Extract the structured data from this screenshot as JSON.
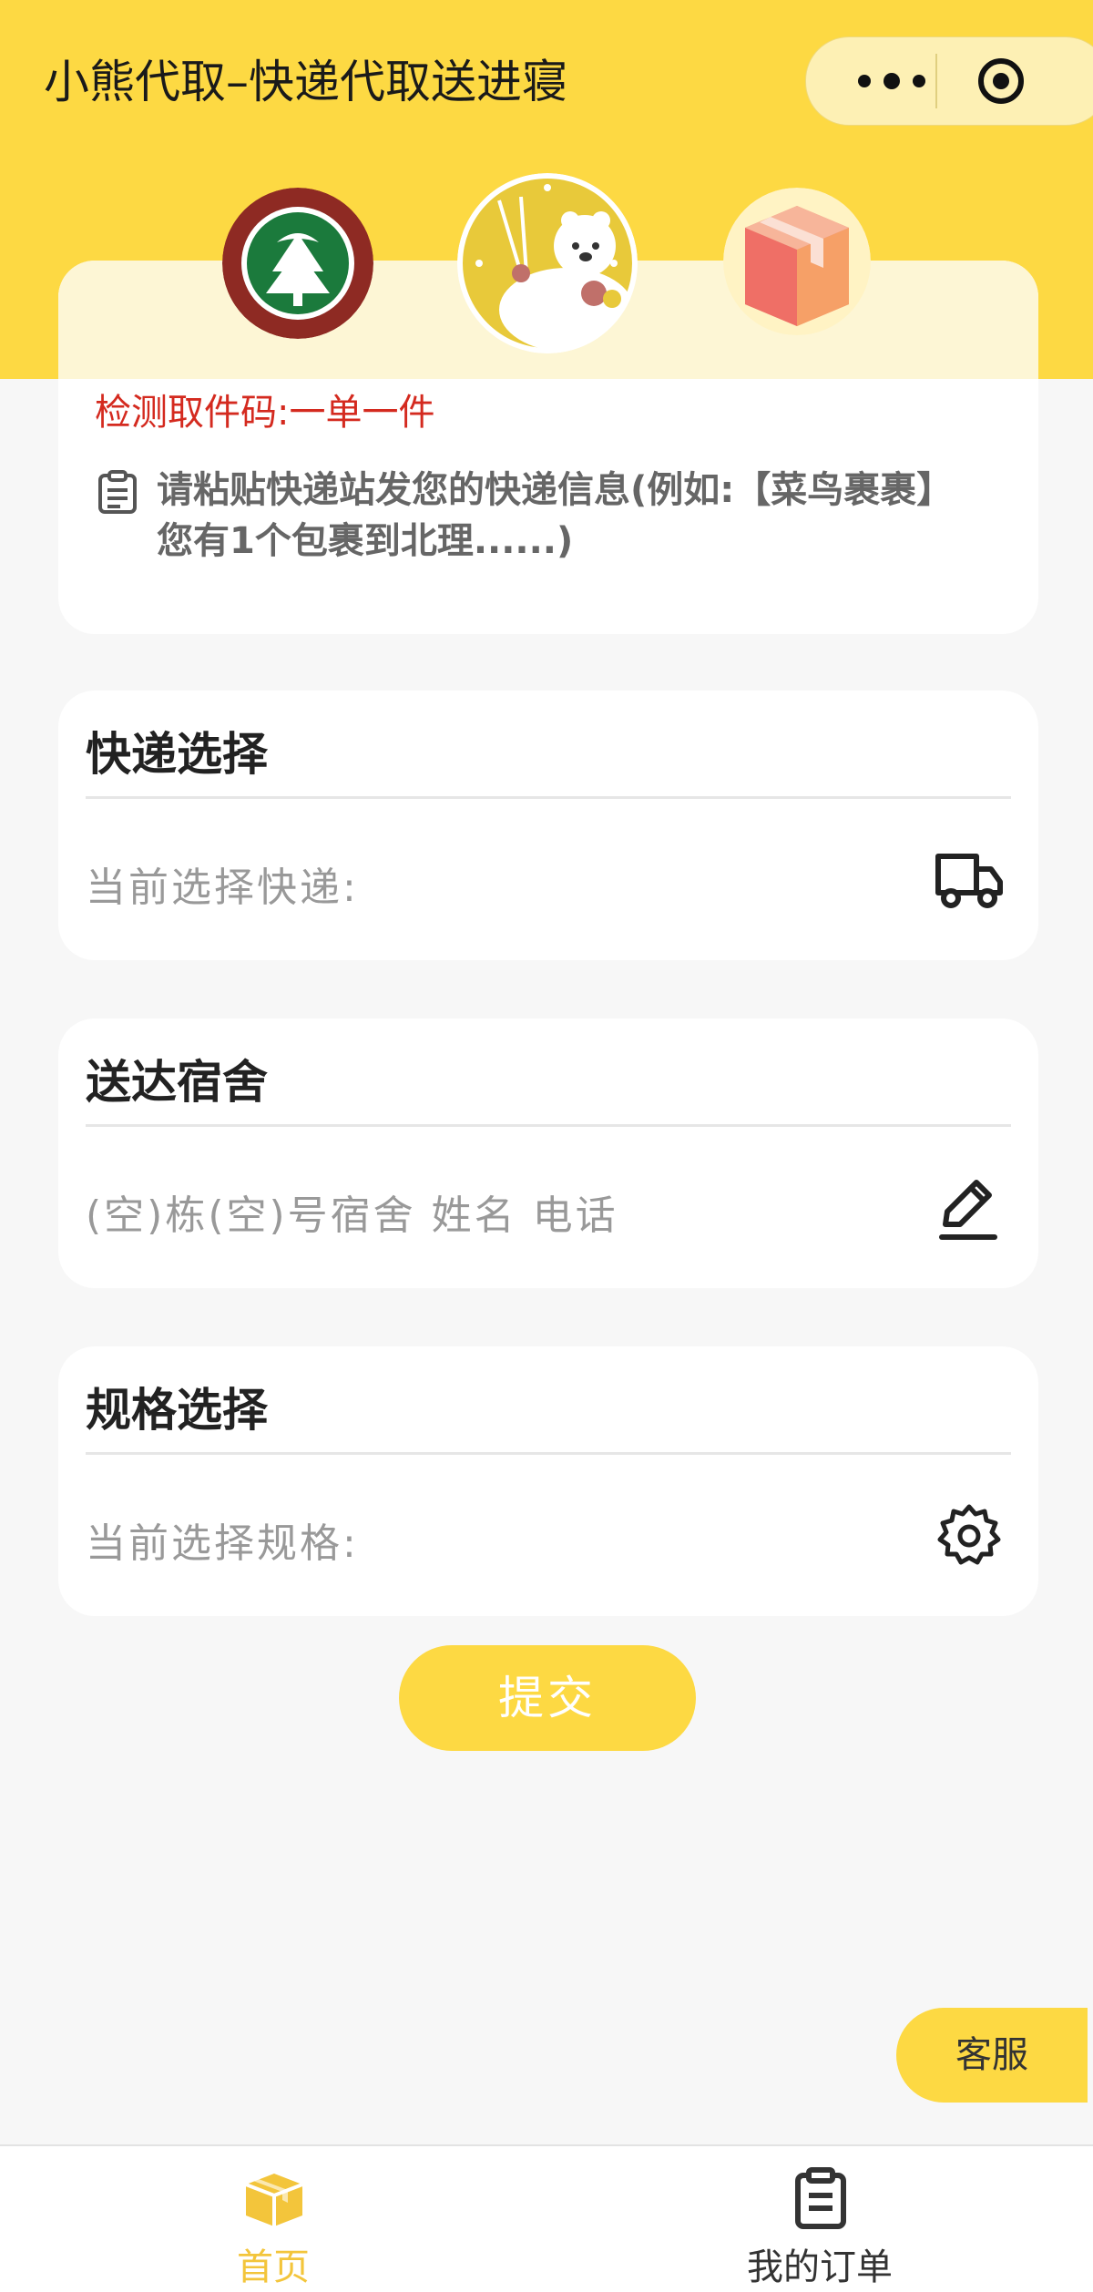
{
  "header": {
    "title": "小熊代取–快递代取送进寝",
    "capsule": {
      "more_icon": "more-dots-icon",
      "close_icon": "target-circle-icon"
    }
  },
  "hero": {
    "logos": [
      "university-emblem",
      "bear-mascot",
      "parcel-box-icon"
    ],
    "pick_code_hint": "检测取件码:一单一件",
    "paste_placeholder": "请粘贴快递站发您的快递信息(例如:【菜鸟裹裹】您有1个包裹到北理......)",
    "paste_icon": "clipboard-icon"
  },
  "cards": {
    "courier": {
      "title": "快递选择",
      "value": "当前选择快递:",
      "icon": "truck-icon"
    },
    "dorm": {
      "title": "送达宿舍",
      "value": "(空)栋(空)号宿舍 姓名 电话",
      "icon": "pencil-icon"
    },
    "spec": {
      "title": "规格选择",
      "value": "当前选择规格:",
      "icon": "gear-icon"
    }
  },
  "submit_label": "提交",
  "support_label": "客服",
  "tabbar": {
    "home": {
      "label": "首页",
      "icon": "box-icon",
      "active": true
    },
    "orders": {
      "label": "我的订单",
      "icon": "clipboard-icon",
      "active": false
    }
  },
  "colors": {
    "brand_yellow": "#fdd943",
    "hint_red": "#d42a1f",
    "active_tab": "#f3c53b",
    "inactive_tab": "#333333"
  }
}
